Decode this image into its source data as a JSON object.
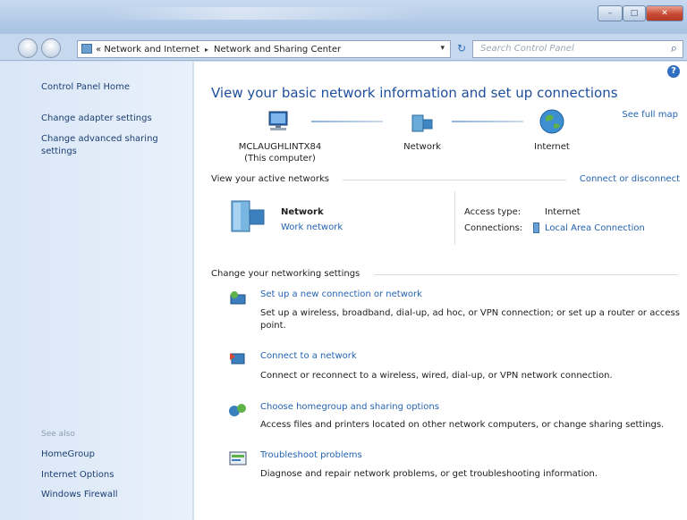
{
  "address": {
    "crumb_root_glyph": "«",
    "crumbs": [
      "Network and Internet",
      "Network and Sharing Center"
    ],
    "separator": "▸",
    "dropdown_glyph": "▾",
    "refresh_glyph": "↻"
  },
  "search": {
    "placeholder": "Search Control Panel"
  },
  "left": {
    "home": "Control Panel Home",
    "adapter": "Change adapter settings",
    "advanced": "Change advanced sharing settings",
    "see_also": "See also",
    "homegroup": "HomeGroup",
    "internet_options": "Internet Options",
    "firewall": "Windows Firewall"
  },
  "main": {
    "title": "View your basic network information and set up connections",
    "see_full_map": "See full map",
    "help_glyph": "?",
    "map": {
      "computer_name": "MCLAUGHLINTX84",
      "computer_sub": "(This computer)",
      "network": "Network",
      "internet": "Internet"
    },
    "active_networks": {
      "heading": "View your active networks",
      "connect_link": "Connect or disconnect",
      "name": "Network",
      "type": "Work network",
      "access_label": "Access type:",
      "access_value": "Internet",
      "connections_label": "Connections:",
      "connections_value": "Local Area Connection"
    },
    "settings": {
      "heading": "Change your networking settings",
      "tasks": [
        {
          "title": "Set up a new connection or network",
          "desc": "Set up a wireless, broadband, dial-up, ad hoc, or VPN connection; or set up a router or access point."
        },
        {
          "title": "Connect to a network",
          "desc": "Connect or reconnect to a wireless, wired, dial-up, or VPN network connection."
        },
        {
          "title": "Choose homegroup and sharing options",
          "desc": "Access files and printers located on other network computers, or change sharing settings."
        },
        {
          "title": "Troubleshoot problems",
          "desc": "Diagnose and repair network problems, or get troubleshooting information."
        }
      ]
    }
  },
  "icons": {
    "back": "back-arrow-icon",
    "forward": "forward-arrow-icon",
    "search": "search-icon",
    "computer": "computer-icon",
    "network": "network-icon",
    "internet": "globe-icon"
  },
  "colors": {
    "link": "#2463b1",
    "title": "#1e4e9b",
    "left_pane": "#e1ecf8"
  }
}
